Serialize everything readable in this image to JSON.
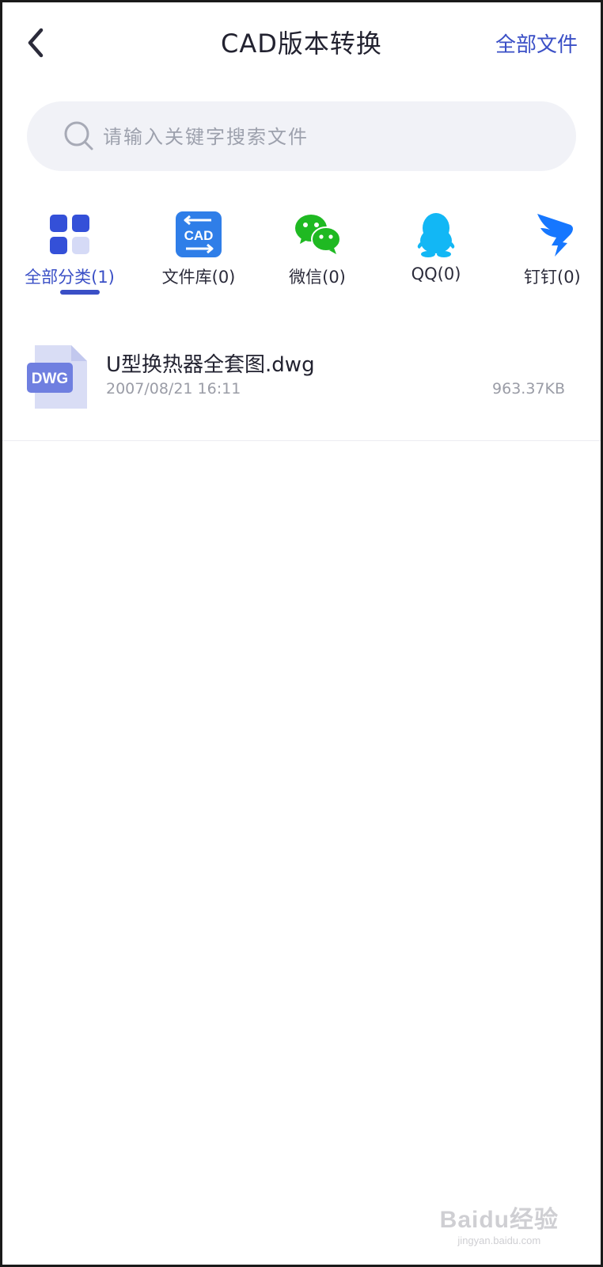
{
  "header": {
    "title": "CAD版本转换",
    "right_link": "全部文件",
    "accent_color": "#3a4fc6"
  },
  "search": {
    "placeholder": "请输入关键字搜索文件",
    "value": ""
  },
  "categories": [
    {
      "label": "全部分类(1)",
      "icon": "grid-icon",
      "active": true
    },
    {
      "label": "文件库(0)",
      "icon": "cad-library-icon",
      "active": false
    },
    {
      "label": "微信(0)",
      "icon": "wechat-icon",
      "active": false
    },
    {
      "label": "QQ(0)",
      "icon": "qq-icon",
      "active": false
    },
    {
      "label": "钉钉(0)",
      "icon": "dingtalk-icon",
      "active": false
    }
  ],
  "cad_icon_text": "CAD",
  "files": [
    {
      "name": "U型换热器全套图.dwg",
      "date": "2007/08/21 16:11",
      "size": "963.37KB",
      "type_badge": "DWG"
    }
  ],
  "watermark": {
    "brand": "Baidu经验",
    "url": "jingyan.baidu.com"
  }
}
